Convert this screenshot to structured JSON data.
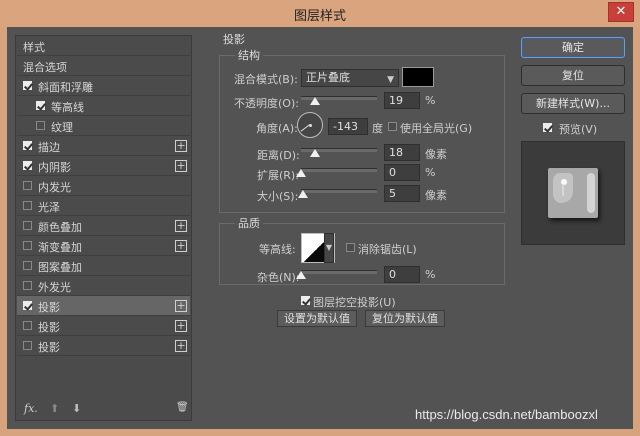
{
  "window": {
    "title": "图层样式",
    "close_glyph": "✕"
  },
  "styles_list": {
    "rows": [
      {
        "label": "样式"
      },
      {
        "label": "混合选项"
      },
      {
        "label": "斜面和浮雕",
        "checked": true
      },
      {
        "label": "等高线",
        "checked": true
      },
      {
        "label": "纹理",
        "checked": false
      },
      {
        "label": "描边",
        "checked": true
      },
      {
        "label": "内阴影",
        "checked": true
      },
      {
        "label": "内发光",
        "checked": false
      },
      {
        "label": "光泽",
        "checked": false
      },
      {
        "label": "颜色叠加",
        "checked": false
      },
      {
        "label": "渐变叠加",
        "checked": false
      },
      {
        "label": "图案叠加",
        "checked": false
      },
      {
        "label": "外发光",
        "checked": false
      },
      {
        "label": "投影",
        "checked": true,
        "selected": true
      },
      {
        "label": "投影",
        "checked": false
      },
      {
        "label": "投影",
        "checked": false
      }
    ],
    "plus_glyph": "+",
    "footer": {
      "fx": "fx.",
      "up": "⬆",
      "down": "⬇",
      "trash": "🗑"
    }
  },
  "drop_shadow": {
    "title": "投影",
    "structure": {
      "title": "结构",
      "blend_mode_label": "混合模式(B):",
      "blend_mode_value": "正片叠底",
      "shadow_color": "#000000",
      "opacity_label": "不透明度(O):",
      "opacity_value": "19",
      "opacity_unit": "%",
      "opacity_level": 0.19,
      "angle_label": "角度(A):",
      "angle_value": "-143",
      "angle_unit": "度",
      "global_light_label": "使用全局光(G)",
      "global_light_checked": false,
      "distance_label": "距离(D):",
      "distance_value": "18",
      "distance_unit": "像素",
      "distance_level": 0.18,
      "spread_label": "扩展(R):",
      "spread_value": "0",
      "spread_unit": "%",
      "spread_level": 0,
      "size_label": "大小(S):",
      "size_value": "5",
      "size_unit": "像素",
      "size_level": 0.02
    },
    "quality": {
      "title": "品质",
      "contour_label": "等高线:",
      "antialias_label": "消除锯齿(L)",
      "antialias_checked": false,
      "noise_label": "杂色(N):",
      "noise_value": "0",
      "noise_unit": "%",
      "noise_level": 0
    },
    "knockout_label": "图层挖空投影(U)",
    "knockout_checked": true,
    "set_default_label": "设置为默认值",
    "reset_default_label": "复位为默认值"
  },
  "actions": {
    "ok_label": "确定",
    "reset_label": "复位",
    "new_style_label": "新建样式(W)...",
    "preview_label": "预览(V)",
    "preview_checked": true
  },
  "watermark": "https://blog.csdn.net/bamboozxl"
}
